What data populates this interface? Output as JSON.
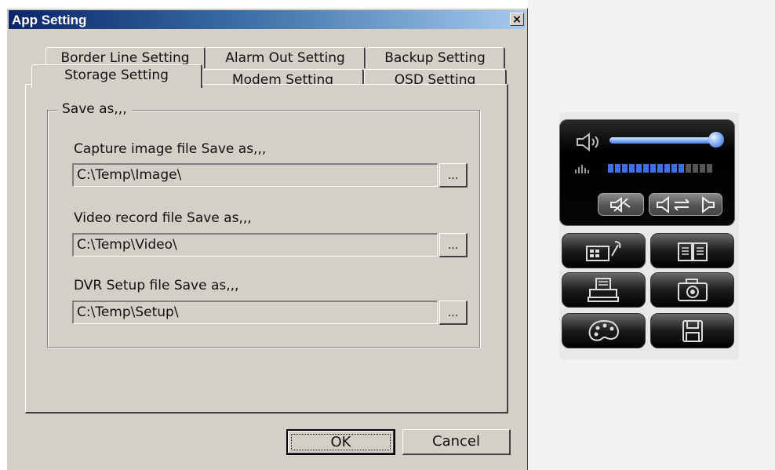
{
  "dialog": {
    "title": "App Setting",
    "close_glyph": "×",
    "tabs_row1": [
      {
        "label": "Border Line Setting"
      },
      {
        "label": "Alarm Out Setting"
      },
      {
        "label": "Backup Setting"
      }
    ],
    "tabs_row2": [
      {
        "label": "Storage Setting",
        "active": true
      },
      {
        "label": "Modem Setting"
      },
      {
        "label": "OSD Setting"
      }
    ],
    "group_title": "Save as,,,",
    "fields": [
      {
        "label": "Capture image file Save as,,,",
        "value": "C:\\Temp\\Image\\",
        "browse": "..."
      },
      {
        "label": "Video record file Save as,,,",
        "value": "C:\\Temp\\Video\\",
        "browse": "..."
      },
      {
        "label": "DVR Setup file Save as,,,",
        "value": "C:\\Temp\\Setup\\",
        "browse": "..."
      }
    ],
    "ok_label": "OK",
    "cancel_label": "Cancel"
  },
  "control_panel": {
    "volume_level": 0.93,
    "level_meter": {
      "total_segments": 15,
      "lit_segments": 11
    },
    "colors": {
      "accent_blue": "#3f6fe8",
      "panel_black": "#000000",
      "meter_off": "#555555"
    },
    "icons": [
      "speaker-volume-icon",
      "level-meter-icon",
      "mute-icon",
      "audio-switch-icon",
      "setup-tool-icon",
      "book-icon",
      "printer-icon",
      "camera-icon",
      "palette-icon",
      "save-disk-icon"
    ]
  }
}
